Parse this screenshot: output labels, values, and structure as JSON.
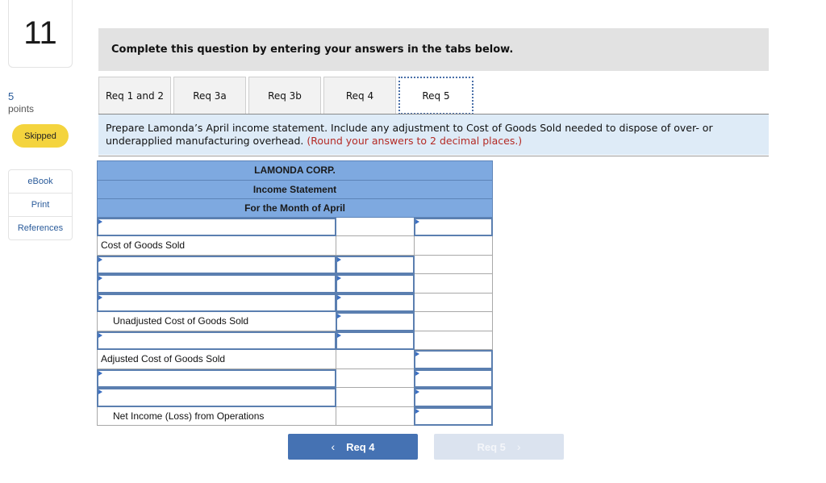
{
  "question": {
    "number": "11",
    "points_value": "5",
    "points_label": "points",
    "status": "Skipped"
  },
  "resources": [
    {
      "label": "eBook"
    },
    {
      "label": "Print"
    },
    {
      "label": "References"
    }
  ],
  "banner": "Complete this question by entering your answers in the tabs below.",
  "tabs": [
    {
      "label": "Req 1 and 2",
      "active": false
    },
    {
      "label": "Req 3a",
      "active": false
    },
    {
      "label": "Req 3b",
      "active": false
    },
    {
      "label": "Req 4",
      "active": false
    },
    {
      "label": "Req 5",
      "active": true
    }
  ],
  "prompt": {
    "text": "Prepare Lamonda’s April income statement. Include any adjustment to Cost of Goods Sold needed to dispose of over- or underapplied manufacturing overhead. ",
    "note": "(Round your answers to 2 decimal places.)"
  },
  "statement": {
    "company": "LAMONDA CORP.",
    "title": "Income Statement",
    "period": "For the Month of April",
    "rows": [
      {
        "label": "",
        "c1_input": true,
        "c2_input": false,
        "c3_input": true,
        "c1_value": "",
        "c2_value": "",
        "c3_value": ""
      },
      {
        "label": "Cost of Goods Sold",
        "c1_input": false,
        "c2_input": false,
        "c3_input": false
      },
      {
        "label": "",
        "c1_input": true,
        "c2_input": true,
        "c3_input": false,
        "c1_value": "",
        "c2_value": ""
      },
      {
        "label": "",
        "c1_input": true,
        "c2_input": true,
        "c3_input": false,
        "c1_value": "",
        "c2_value": ""
      },
      {
        "label": "",
        "c1_input": true,
        "c2_input": true,
        "c3_input": false,
        "c1_value": "",
        "c2_value": ""
      },
      {
        "label": "Unadjusted Cost of Goods Sold",
        "c1_input": false,
        "c2_input": true,
        "c3_input": false,
        "c2_value": ""
      },
      {
        "label": "",
        "c1_input": true,
        "c2_input": true,
        "c3_input": false,
        "c1_value": "",
        "c2_value": ""
      },
      {
        "label": "Adjusted Cost of Goods Sold",
        "c1_input": false,
        "c2_input": false,
        "c3_input": true,
        "c3_value": ""
      },
      {
        "label": "",
        "c1_input": true,
        "c2_input": false,
        "c3_input": true,
        "c1_value": "",
        "c3_value": ""
      },
      {
        "label": "",
        "c1_input": true,
        "c2_input": false,
        "c3_input": true,
        "c1_value": "",
        "c3_value": ""
      },
      {
        "label": "Net Income (Loss) from Operations",
        "c1_input": false,
        "c2_input": false,
        "c3_input": true,
        "c3_value": ""
      }
    ]
  },
  "nav": {
    "prev_label": "Req 4",
    "next_label": "Req 5",
    "prev_icon": "chevron-left-icon",
    "next_icon": "chevron-right-icon",
    "next_disabled": true
  },
  "colors": {
    "header_blue": "#7ea9e0",
    "prompt_bg": "#deebf7",
    "note_red": "#b42a25",
    "skipped_yellow": "#f4d43e",
    "primary_button": "#4572b3"
  }
}
